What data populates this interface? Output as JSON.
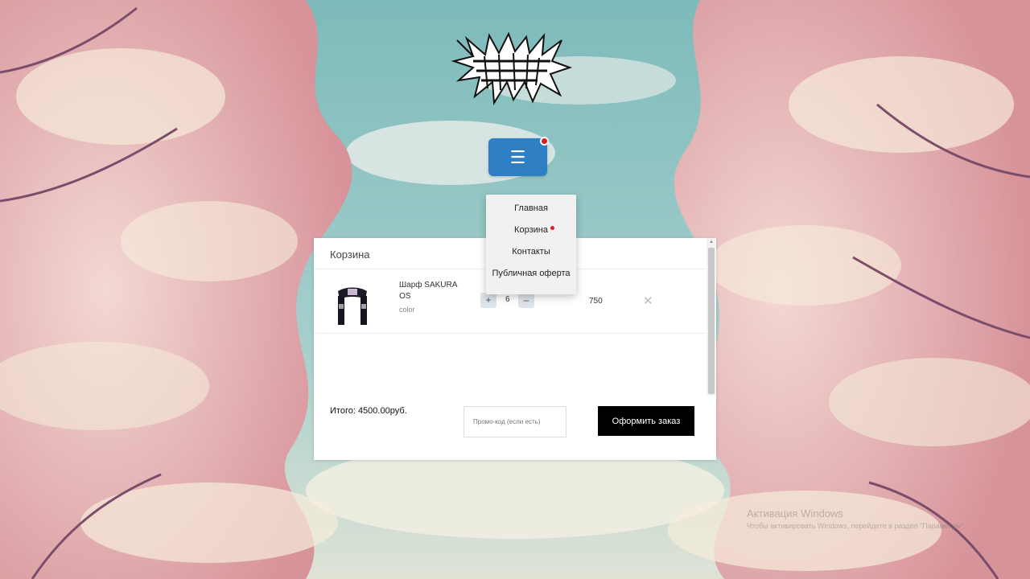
{
  "menu": {
    "button_icon": "hamburger-icon",
    "button_glyph": "☰",
    "notification": "red-dot",
    "items": [
      {
        "label": "Главная"
      },
      {
        "label": "Корзина"
      },
      {
        "label": "Контакты"
      },
      {
        "label": "Публичная оферта"
      }
    ]
  },
  "cart": {
    "title": "Корзина",
    "items": [
      {
        "name": "Шарф SAKURA OS",
        "option": "color",
        "quantity": "6",
        "plus_label": "+",
        "minus_label": "–",
        "price": "750",
        "remove_glyph": "✕"
      }
    ],
    "total_label": "Итого: 4500.00руб.",
    "promo_placeholder": "Промо-код (если есть)",
    "order_button": "Оформить заказ"
  },
  "watermark": {
    "line1": "Активация Windows",
    "line2": "Чтобы активировать Windows, перейдите в раздел \"Параметры\"."
  },
  "colors": {
    "menu_button": "#2f7fc4",
    "notification": "#e01c1c",
    "order_button": "#000000"
  }
}
